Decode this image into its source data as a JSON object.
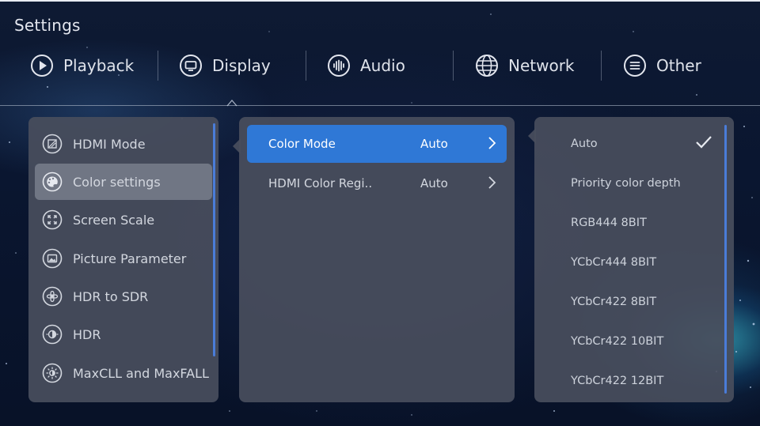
{
  "header": {
    "title": "Settings"
  },
  "tabs": [
    {
      "label": "Playback",
      "icon": "play-icon"
    },
    {
      "label": "Display",
      "icon": "monitor-icon",
      "selected": true
    },
    {
      "label": "Audio",
      "icon": "audio-waveform-icon"
    },
    {
      "label": "Network",
      "icon": "globe-icon"
    },
    {
      "label": "Other",
      "icon": "list-icon"
    }
  ],
  "sidebar": {
    "items": [
      {
        "label": "HDMI Mode",
        "icon": "hdmi-mode-icon"
      },
      {
        "label": "Color settings",
        "icon": "palette-icon",
        "selected": true
      },
      {
        "label": "Screen Scale",
        "icon": "screen-scale-icon"
      },
      {
        "label": "Picture Parameter",
        "icon": "picture-icon"
      },
      {
        "label": "HDR to SDR",
        "icon": "hdr-to-sdr-icon"
      },
      {
        "label": "HDR",
        "icon": "hdr-icon"
      },
      {
        "label": "MaxCLL and MaxFALL",
        "icon": "brightness-icon"
      }
    ]
  },
  "color_settings": {
    "rows": [
      {
        "label": "Color Mode",
        "value": "Auto",
        "selected": true
      },
      {
        "label": "HDMI Color Regi..",
        "value": "Auto"
      }
    ]
  },
  "color_mode_options": {
    "options": [
      {
        "label": "Auto",
        "checked": true
      },
      {
        "label": "Priority color depth"
      },
      {
        "label": "RGB444 8BIT"
      },
      {
        "label": "YCbCr444 8BIT"
      },
      {
        "label": "YCbCr422 8BIT"
      },
      {
        "label": "YCbCr422 10BIT"
      },
      {
        "label": "YCbCr422 12BIT"
      }
    ]
  },
  "colors": {
    "accent": "#2f78d6",
    "scrollbar": "#4a7cd8",
    "panel": "#484e5c"
  }
}
